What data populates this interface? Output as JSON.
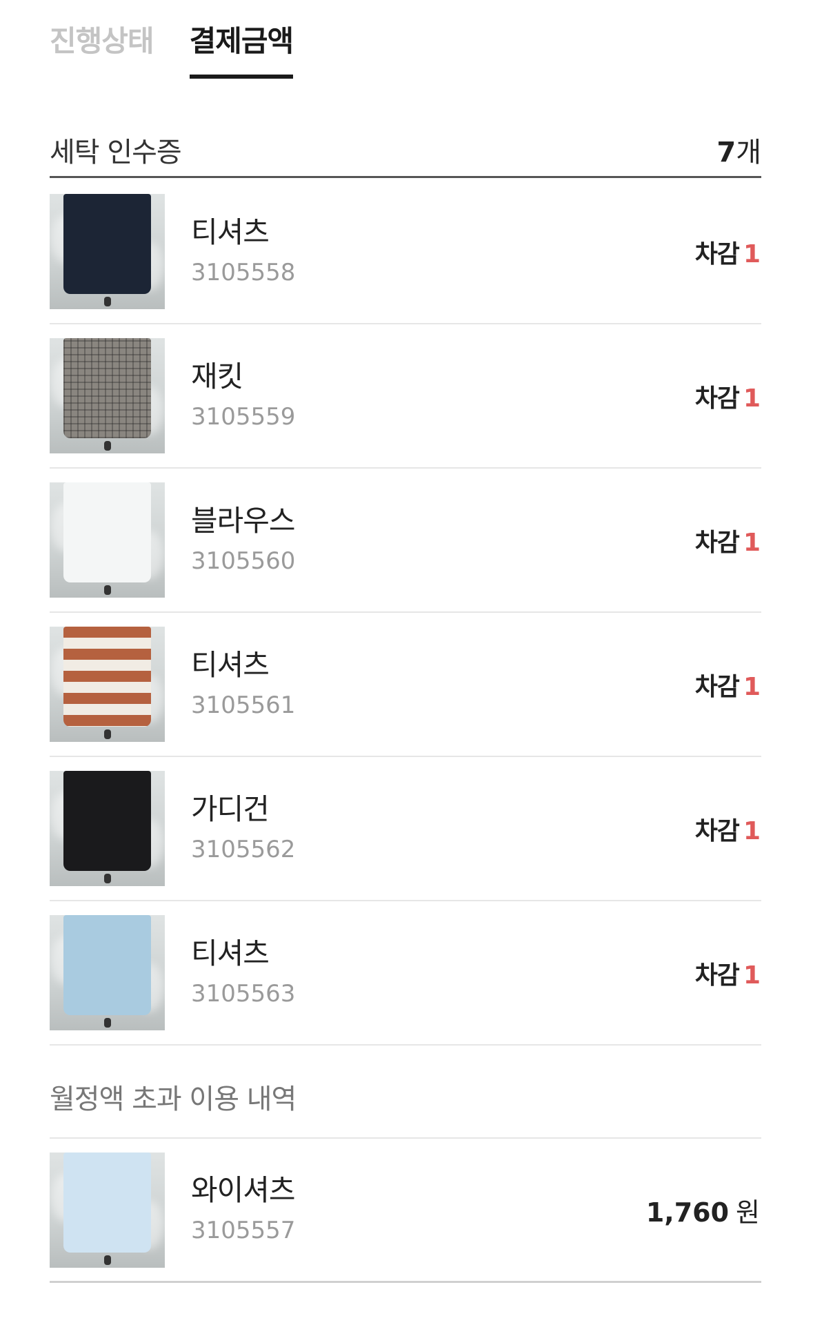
{
  "tabs": [
    {
      "label": "진행상태",
      "active": false
    },
    {
      "label": "결제금액",
      "active": true
    }
  ],
  "receipt": {
    "title": "세탁 인수증",
    "count_num": "7",
    "count_unit": "개",
    "items": [
      {
        "name": "티셔츠",
        "code": "3105558",
        "deduct_label": "차감",
        "deduct_value": "1",
        "garment_color": "#1c2535",
        "garment_style": "solid"
      },
      {
        "name": "재킷",
        "code": "3105559",
        "deduct_label": "차감",
        "deduct_value": "1",
        "garment_color": "#8a8680",
        "garment_style": "check"
      },
      {
        "name": "블라우스",
        "code": "3105560",
        "deduct_label": "차감",
        "deduct_value": "1",
        "garment_color": "#f4f6f6",
        "garment_style": "solid"
      },
      {
        "name": "티셔츠",
        "code": "3105561",
        "deduct_label": "차감",
        "deduct_value": "1",
        "garment_color": "#b5613f",
        "garment_style": "stripe"
      },
      {
        "name": "가디건",
        "code": "3105562",
        "deduct_label": "차감",
        "deduct_value": "1",
        "garment_color": "#1a1a1c",
        "garment_style": "solid"
      },
      {
        "name": "티셔츠",
        "code": "3105563",
        "deduct_label": "차감",
        "deduct_value": "1",
        "garment_color": "#a9cbe0",
        "garment_style": "solid"
      }
    ]
  },
  "overage": {
    "title": "월정액 초과 이용 내역",
    "items": [
      {
        "name": "와이셔츠",
        "code": "3105557",
        "amount": "1,760",
        "unit": "원",
        "garment_color": "#cfe3f2",
        "garment_style": "solid"
      }
    ]
  },
  "colors": {
    "accent_red": "#e05a5a",
    "tab_inactive": "#c4c4c4",
    "text_dark": "#1a1a1a"
  }
}
